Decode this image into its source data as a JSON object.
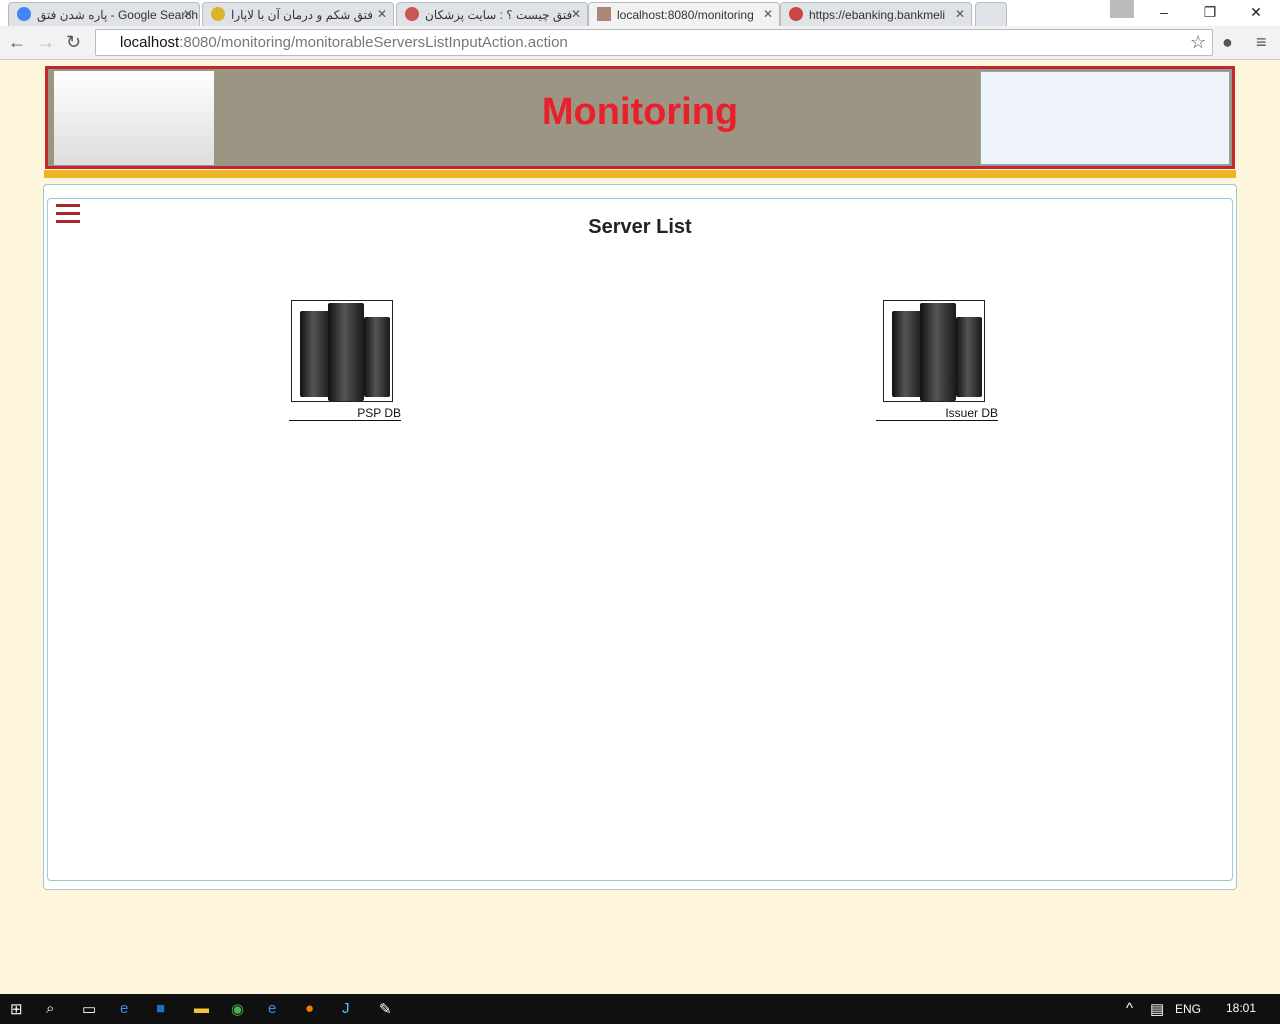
{
  "browser": {
    "tabs": [
      {
        "title": "پاره شدن فتق - Google Search"
      },
      {
        "title": "فتق شکم و درمان آن با لاپارا"
      },
      {
        "title": "فتق چیست ؟ : سایت پزشکان"
      },
      {
        "title": "localhost:8080/monitoring"
      },
      {
        "title": "https://ebanking.bankmeli"
      }
    ],
    "url_host": "localhost",
    "url_rest": ":8080/monitoring/monitorableServersListInputAction.action"
  },
  "banner": {
    "title": "Monitoring"
  },
  "page": {
    "title": "Server List"
  },
  "servers": [
    {
      "label": "PSP DB"
    },
    {
      "label": "Issuer DB"
    }
  ],
  "taskbar": {
    "lang": "ENG",
    "time": "18:01"
  }
}
